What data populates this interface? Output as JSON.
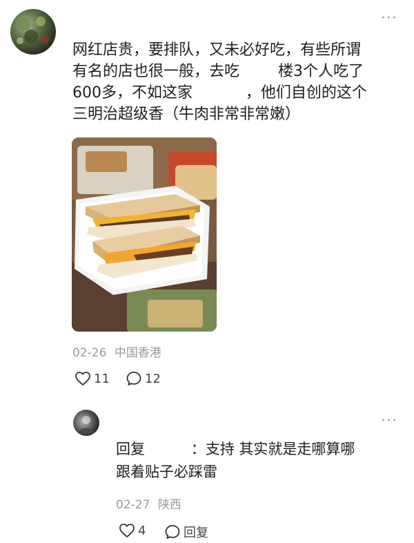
{
  "post": {
    "text_lines": [
      "网红店贵，要排队，又未必好吃，有些所谓",
      "有名的店也很一般，去吃        楼3个人吃了",
      "600多，不如这家           ，他们自创的这个",
      "三明治超级香（牛肉非常非常嫩）"
    ],
    "date": "02-26",
    "location": "中国香港",
    "likes": "11",
    "comments": "12",
    "more_glyph": "···"
  },
  "reply": {
    "text_lines": [
      "回复          ：支持 其实就是走哪算哪",
      "跟着贴子必踩雷"
    ],
    "date": "02-27",
    "location": "陕西",
    "likes": "4",
    "reply_label": "回复",
    "more_glyph": "···"
  },
  "colors": {
    "meta": "#9a9a9a",
    "text": "#1f1f1f",
    "icon": "#333333"
  },
  "icons": [
    "heart-icon",
    "comment-bubble-icon",
    "more-icon"
  ]
}
